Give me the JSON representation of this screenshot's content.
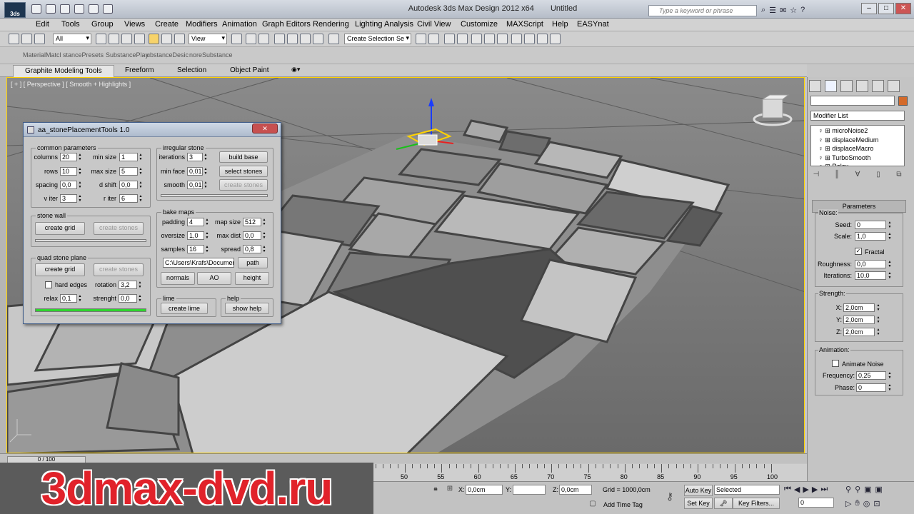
{
  "window": {
    "app_title": "Autodesk 3ds Max Design 2012 x64",
    "doc_title": "Untitled",
    "search_placeholder": "Type a keyword or phrase",
    "minimize": "–",
    "maximize": "□",
    "close": "✕"
  },
  "menu": [
    "Edit",
    "Tools",
    "Group",
    "Views",
    "Create",
    "Modifiers",
    "Animation",
    "Graph Editors",
    "Rendering",
    "Lighting Analysis",
    "Civil View",
    "Customize",
    "MAXScript",
    "Help",
    "EASYnat"
  ],
  "toolbar": {
    "filter_select": "All",
    "ref_coord_select": "View",
    "selection_set": "Create Selection Se"
  },
  "command_tabs": [
    "MaterialMatcl",
    "stancePresets",
    "SubstancePlay",
    "ubstanceDesic",
    "noreSubstance"
  ],
  "ribbon_tabs": [
    "Graphite Modeling Tools",
    "Freeform",
    "Selection",
    "Object Paint"
  ],
  "viewport": {
    "label": "[ + ] [ Perspective ] [ Smooth + Highlights ]"
  },
  "dialog": {
    "title": "aa_stonePlacementTools 1.0",
    "close": "✕",
    "common": {
      "title": "common parameters",
      "columns_label": "columns",
      "columns": "20",
      "rows_label": "rows",
      "rows": "10",
      "spacing_label": "spacing",
      "spacing": "0,0",
      "v_iter_label": "v iter",
      "v_iter": "3",
      "min_size_label": "min size",
      "min_size": "1",
      "max_size_label": "max size",
      "max_size": "5",
      "d_shift_label": "d shift",
      "d_shift": "0,0",
      "r_iter_label": "r iter",
      "r_iter": "6"
    },
    "irregular": {
      "title": "irregular stone",
      "iterations_label": "iterations",
      "iterations": "3",
      "min_face_label": "min face",
      "min_face": "0,01",
      "smooth_label": "smooth",
      "smooth": "0,01",
      "build_base": "build base",
      "select_stones": "select stones",
      "create_stones": "create stones"
    },
    "stone_wall": {
      "title": "stone wall",
      "create_grid": "create grid",
      "create_stones": "create stones"
    },
    "quad_plane": {
      "title": "quad stone plane",
      "create_grid": "create grid",
      "create_stones": "create stones",
      "hard_edges": "hard edges",
      "rotation_label": "rotation",
      "rotation": "3,2",
      "relax_label": "relax",
      "relax": "0,1",
      "strenght_label": "strenght",
      "strenght": "0,0",
      "progress": 1.0
    },
    "bake": {
      "title": "bake maps",
      "padding_label": "padding",
      "padding": "4",
      "oversize_label": "oversize",
      "oversize": "1,0",
      "samples_label": "samples",
      "samples": "16",
      "map_size_label": "map size",
      "map_size": "512",
      "max_dist_label": "max dist",
      "max_dist": "0,0",
      "spread_label": "spread",
      "spread": "0,8",
      "path_value": "C:\\Users\\Krafs\\Documen",
      "path_button": "path",
      "normals": "normals",
      "ao": "AO",
      "height": "height"
    },
    "lime": {
      "title": "lime",
      "button": "create lime"
    },
    "help": {
      "title": "help",
      "button": "show help"
    }
  },
  "command_panel": {
    "modifier_list": "Modifier List",
    "stack": [
      "microNoise2",
      "displaceMedium",
      "displaceMacro",
      "TurboSmooth",
      "Relax"
    ],
    "parameters": "Parameters",
    "noise_title": "Noise:",
    "seed_label": "Seed:",
    "seed": "0",
    "scale_label": "Scale:",
    "scale": "1,0",
    "fractal_label": "Fractal",
    "roughness_label": "Roughness:",
    "roughness": "0,0",
    "iterations_label": "Iterations:",
    "iterations": "10,0",
    "strength_title": "Strength:",
    "x_label": "X:",
    "x": "2,0cm",
    "y_label": "Y:",
    "y": "2,0cm",
    "z_label": "Z:",
    "z": "2,0cm",
    "animation_title": "Animation:",
    "animate_noise_label": "Animate Noise",
    "frequency_label": "Frequency:",
    "frequency": "0,25",
    "phase_label": "Phase:",
    "phase": "0"
  },
  "timeline": {
    "slider": "0 / 100",
    "ticks": [
      "50",
      "55",
      "60",
      "65",
      "70",
      "75",
      "80",
      "85",
      "90",
      "95",
      "100"
    ]
  },
  "status": {
    "x_label": "X:",
    "x": "0,0cm",
    "y_label": "Y:",
    "y": "",
    "z_label": "Z:",
    "z": "0,0cm",
    "grid": "Grid = 1000,0cm",
    "add_time_tag": "Add Time Tag",
    "auto_key": "Auto Key",
    "set_key": "Set Key",
    "selected": "Selected",
    "key_filters": "Key Filters...",
    "frame": "0"
  },
  "watermark": "3dmax-dvd.ru",
  "colors": {
    "accent_viewport_border": "#ffd200",
    "progress_green": "#2dd52d",
    "object_color": "#d46a2a",
    "watermark_red": "#e1222a"
  }
}
